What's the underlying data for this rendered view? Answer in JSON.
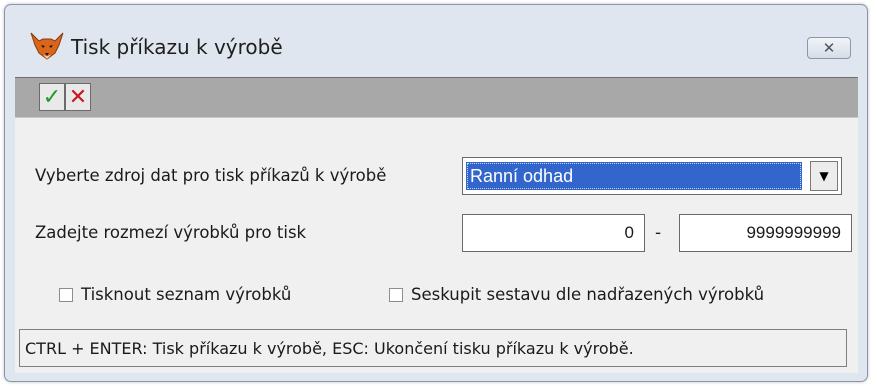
{
  "window": {
    "title": "Tisk příkazu k výrobě",
    "close_symbol": "✕",
    "app_icon": "fox-icon"
  },
  "toolbar": {
    "ok_symbol": "✓",
    "cancel_symbol": "✕"
  },
  "form": {
    "source_label": "Vyberte zdroj dat pro tisk příkazů k výrobě",
    "source_value": "Ranní odhad",
    "range_label": "Zadejte rozmezí výrobků pro tisk",
    "range_from": "0",
    "range_separator": "-",
    "range_to": "9999999999",
    "print_list_label": "Tisknout seznam výrobků",
    "print_list_checked": false,
    "group_label": "Seskupit sestavu dle nadřazených výrobků",
    "group_checked": false
  },
  "status": {
    "text": "CTRL + ENTER: Tisk příkazu k výrobě, ESC: Ukončení tisku příkazu k výrobě."
  },
  "colors": {
    "selection": "#3366cc",
    "ok_green": "#1f9a1f",
    "cancel_red": "#c8181e",
    "toolbar_gray": "#a8a8a8"
  }
}
